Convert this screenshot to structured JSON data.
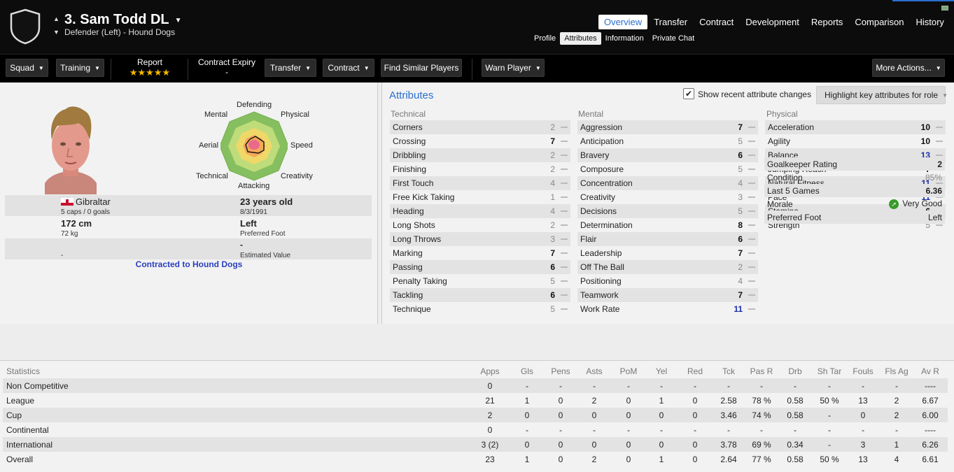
{
  "header": {
    "player_name": "3. Sam Todd DL",
    "subtitle": "Defender (Left) - Hound Dogs",
    "tabs": [
      {
        "label": "Overview",
        "active": true
      },
      {
        "label": "Transfer",
        "active": false
      },
      {
        "label": "Contract",
        "active": false
      },
      {
        "label": "Development",
        "active": false
      },
      {
        "label": "Reports",
        "active": false
      },
      {
        "label": "Comparison",
        "active": false
      },
      {
        "label": "History",
        "active": false
      }
    ],
    "subtabs": [
      {
        "label": "Profile",
        "active": false
      },
      {
        "label": "Attributes",
        "active": true
      },
      {
        "label": "Information",
        "active": false
      },
      {
        "label": "Private Chat",
        "active": false
      }
    ]
  },
  "toolbar": {
    "squad": "Squad",
    "training": "Training",
    "report_label": "Report",
    "report_stars": "★★★★★",
    "contract_expiry_label": "Contract Expiry",
    "contract_expiry_value": "-",
    "transfer": "Transfer",
    "contract": "Contract",
    "find_similar": "Find Similar Players",
    "warn_player": "Warn Player",
    "more_actions": "More Actions..."
  },
  "radar": {
    "labels": {
      "defending": "Defending",
      "physical": "Physical",
      "speed": "Speed",
      "creativity": "Creativity",
      "attacking": "Attacking",
      "technical": "Technical",
      "aerial": "Aerial",
      "mental": "Mental"
    }
  },
  "profile": {
    "nation": "Gibraltar",
    "caps": "5 caps / 0 goals",
    "age": "23 years old",
    "dob": "8/3/1991",
    "height": "172 cm",
    "weight": "72 kg",
    "foot": "Left",
    "foot_label": "Preferred Foot",
    "value": "-",
    "value_label": "Estimated Value",
    "left_dash": "-",
    "contracted": "Contracted to Hound Dogs"
  },
  "attributes": {
    "title": "Attributes",
    "show_changes": "Show recent attribute changes",
    "highlight": "Highlight key attributes for role",
    "technical_header": "Technical",
    "mental_header": "Mental",
    "physical_header": "Physical",
    "technical": [
      {
        "name": "Corners",
        "value": "2"
      },
      {
        "name": "Crossing",
        "value": "7"
      },
      {
        "name": "Dribbling",
        "value": "2"
      },
      {
        "name": "Finishing",
        "value": "2"
      },
      {
        "name": "First Touch",
        "value": "4"
      },
      {
        "name": "Free Kick Taking",
        "value": "1"
      },
      {
        "name": "Heading",
        "value": "4"
      },
      {
        "name": "Long Shots",
        "value": "2"
      },
      {
        "name": "Long Throws",
        "value": "3"
      },
      {
        "name": "Marking",
        "value": "7"
      },
      {
        "name": "Passing",
        "value": "6"
      },
      {
        "name": "Penalty Taking",
        "value": "5"
      },
      {
        "name": "Tackling",
        "value": "6"
      },
      {
        "name": "Technique",
        "value": "5"
      }
    ],
    "mental": [
      {
        "name": "Aggression",
        "value": "7"
      },
      {
        "name": "Anticipation",
        "value": "5"
      },
      {
        "name": "Bravery",
        "value": "6"
      },
      {
        "name": "Composure",
        "value": "5"
      },
      {
        "name": "Concentration",
        "value": "4"
      },
      {
        "name": "Creativity",
        "value": "3"
      },
      {
        "name": "Decisions",
        "value": "5"
      },
      {
        "name": "Determination",
        "value": "8"
      },
      {
        "name": "Flair",
        "value": "6"
      },
      {
        "name": "Leadership",
        "value": "7"
      },
      {
        "name": "Off The Ball",
        "value": "2"
      },
      {
        "name": "Positioning",
        "value": "4"
      },
      {
        "name": "Teamwork",
        "value": "7"
      },
      {
        "name": "Work Rate",
        "value": "11"
      }
    ],
    "physical": [
      {
        "name": "Acceleration",
        "value": "10"
      },
      {
        "name": "Agility",
        "value": "10"
      },
      {
        "name": "Balance",
        "value": "13"
      },
      {
        "name": "Jumping Reach",
        "value": "7"
      },
      {
        "name": "Natural Fitness",
        "value": "11"
      },
      {
        "name": "Pace",
        "value": "11"
      },
      {
        "name": "Stamina",
        "value": "6"
      },
      {
        "name": "Strength",
        "value": "5"
      }
    ],
    "summary": {
      "gk_label": "Goalkeeper Rating",
      "gk_value": "2",
      "condition_label": "Condition",
      "condition_value": "85%",
      "last5_label": "Last 5 Games",
      "last5_value": "6.36",
      "morale_label": "Morale",
      "morale_value": "Very Good",
      "foot_label": "Preferred Foot",
      "foot_value": "Left"
    }
  },
  "statistics": {
    "headers": [
      "Statistics",
      "Apps",
      "Gls",
      "Pens",
      "Asts",
      "PoM",
      "Yel",
      "Red",
      "Tck",
      "Pas R",
      "Drb",
      "Sh Tar",
      "Fouls",
      "Fls Ag",
      "Av R"
    ],
    "rows": [
      [
        "Non Competitive",
        "0",
        "-",
        "-",
        "-",
        "-",
        "-",
        "-",
        "-",
        "-",
        "-",
        "-",
        "-",
        "-",
        "----"
      ],
      [
        "League",
        "21",
        "1",
        "0",
        "2",
        "0",
        "1",
        "0",
        "2.58",
        "78 %",
        "0.58",
        "50 %",
        "13",
        "2",
        "6.67"
      ],
      [
        "Cup",
        "2",
        "0",
        "0",
        "0",
        "0",
        "0",
        "0",
        "3.46",
        "74 %",
        "0.58",
        "-",
        "0",
        "2",
        "6.00"
      ],
      [
        "Continental",
        "0",
        "-",
        "-",
        "-",
        "-",
        "-",
        "-",
        "-",
        "-",
        "-",
        "-",
        "-",
        "-",
        "----"
      ],
      [
        "International",
        "3 (2)",
        "0",
        "0",
        "0",
        "0",
        "0",
        "0",
        "3.78",
        "69 %",
        "0.34",
        "-",
        "3",
        "1",
        "6.26"
      ],
      [
        "Overall",
        "23",
        "1",
        "0",
        "2",
        "0",
        "1",
        "0",
        "2.64",
        "77 %",
        "0.58",
        "50 %",
        "13",
        "4",
        "6.61"
      ]
    ]
  },
  "colors": {
    "accent": "#2a6fcf",
    "highlight_value": "#1a2fa8",
    "contract_link": "#2a3fbf"
  }
}
